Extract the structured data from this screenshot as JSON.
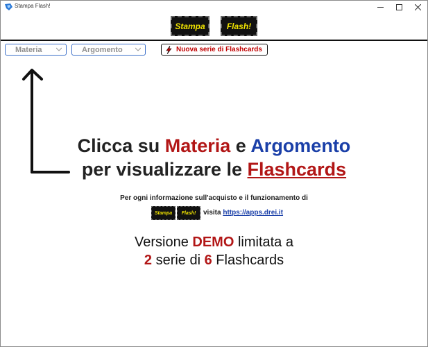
{
  "window": {
    "title": "Stampa Flash!"
  },
  "logo": {
    "word1": "Stampa",
    "word2": "Flash!"
  },
  "toolbar": {
    "materia_label": "Materia",
    "argomento_label": "Argomento",
    "new_series_label": "Nuova serie di Flashcards"
  },
  "headline": {
    "line1_prefix": "Clicca su ",
    "line1_materia": "Materia",
    "line1_and": " e ",
    "line1_argomento": "Argomento",
    "line2_prefix": "per visualizzare le ",
    "line2_flashcards": "Flashcards"
  },
  "info": {
    "text": "Per ogni informazione sull'acquisto e il funzionamento di",
    "visit_prefix": "visita ",
    "link": "https://apps.drei.it"
  },
  "demo": {
    "line1_prefix": "Versione ",
    "line1_demo": "DEMO",
    "line1_suffix": " limitata a",
    "line2_num1": "2",
    "line2_mid": " serie di ",
    "line2_num2": "6",
    "line2_suffix": " Flashcards"
  },
  "colors": {
    "accent_red": "#b21616",
    "accent_blue": "#1a3fa8",
    "logo_yellow": "#f1e400"
  }
}
